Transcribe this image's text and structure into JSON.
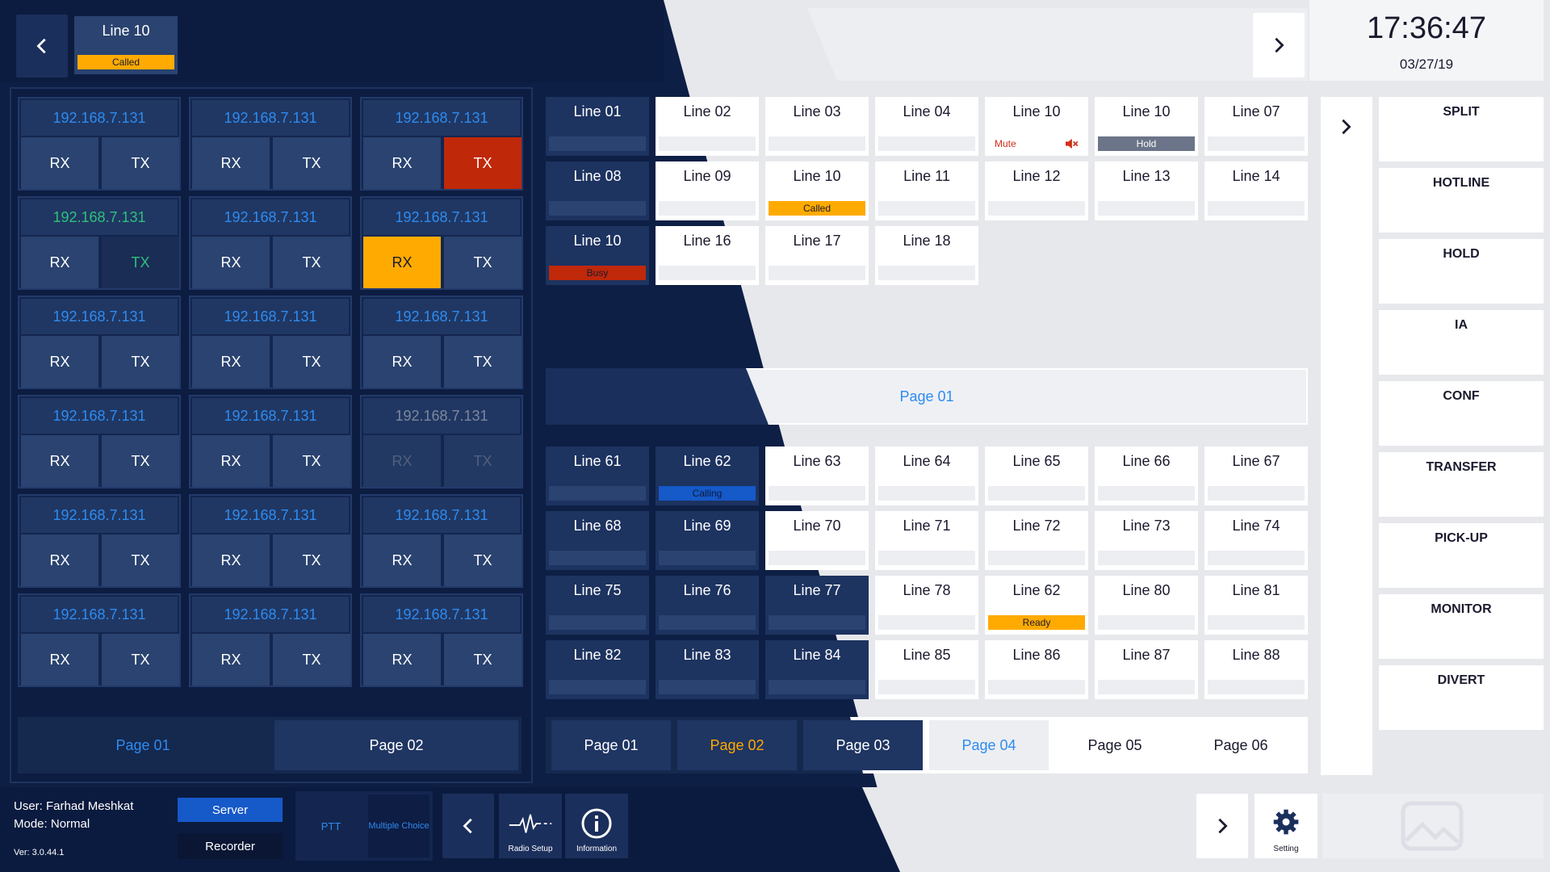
{
  "top": {
    "active_line_label": "Line 10",
    "active_line_status": "Called",
    "time": "17:36:47",
    "date": "03/27/19"
  },
  "radios": [
    {
      "ip": "192.168.7.131",
      "rx": "RX",
      "tx": "TX"
    },
    {
      "ip": "192.168.7.131",
      "rx": "RX",
      "tx": "TX"
    },
    {
      "ip": "192.168.7.131",
      "rx": "RX",
      "tx": "TX"
    },
    {
      "ip": "192.168.7.131",
      "rx": "RX",
      "tx": "TX"
    },
    {
      "ip": "192.168.7.131",
      "rx": "RX",
      "tx": "TX"
    },
    {
      "ip": "192.168.7.131",
      "rx": "RX",
      "tx": "TX"
    },
    {
      "ip": "192.168.7.131",
      "rx": "RX",
      "tx": "TX"
    },
    {
      "ip": "192.168.7.131",
      "rx": "RX",
      "tx": "TX"
    },
    {
      "ip": "192.168.7.131",
      "rx": "RX",
      "tx": "TX"
    },
    {
      "ip": "192.168.7.131",
      "rx": "RX",
      "tx": "TX"
    },
    {
      "ip": "192.168.7.131",
      "rx": "RX",
      "tx": "TX"
    },
    {
      "ip": "192.168.7.131",
      "rx": "RX",
      "tx": "TX"
    },
    {
      "ip": "192.168.7.131",
      "rx": "RX",
      "tx": "TX"
    },
    {
      "ip": "192.168.7.131",
      "rx": "RX",
      "tx": "TX"
    },
    {
      "ip": "192.168.7.131",
      "rx": "RX",
      "tx": "TX"
    },
    {
      "ip": "192.168.7.131",
      "rx": "RX",
      "tx": "TX"
    },
    {
      "ip": "192.168.7.131",
      "rx": "RX",
      "tx": "TX"
    },
    {
      "ip": "192.168.7.131",
      "rx": "RX",
      "tx": "TX"
    }
  ],
  "radio_pages": [
    "Page 01",
    "Page 02"
  ],
  "lines_top": [
    {
      "label": "Line 01",
      "status": ""
    },
    {
      "label": "Line 02",
      "status": ""
    },
    {
      "label": "Line 03",
      "status": ""
    },
    {
      "label": "Line 04",
      "status": ""
    },
    {
      "label": "Line 10",
      "status": "Mute"
    },
    {
      "label": "Line 10",
      "status": "Hold"
    },
    {
      "label": "Line 07",
      "status": ""
    },
    {
      "label": "Line 08",
      "status": ""
    },
    {
      "label": "Line 09",
      "status": ""
    },
    {
      "label": "Line 10",
      "status": "Called"
    },
    {
      "label": "Line 11",
      "status": ""
    },
    {
      "label": "Line 12",
      "status": ""
    },
    {
      "label": "Line 13",
      "status": ""
    },
    {
      "label": "Line 14",
      "status": ""
    },
    {
      "label": "Line 10",
      "status": "Busy"
    },
    {
      "label": "Line 16",
      "status": ""
    },
    {
      "label": "Line 17",
      "status": ""
    },
    {
      "label": "Line 18",
      "status": ""
    }
  ],
  "middle_page": "Page 01",
  "lines_bottom": [
    {
      "label": "Line 61",
      "status": ""
    },
    {
      "label": "Line 62",
      "status": "Calling"
    },
    {
      "label": "Line 63",
      "status": ""
    },
    {
      "label": "Line 64",
      "status": ""
    },
    {
      "label": "Line 65",
      "status": ""
    },
    {
      "label": "Line 66",
      "status": ""
    },
    {
      "label": "Line 67",
      "status": ""
    },
    {
      "label": "Line 68",
      "status": ""
    },
    {
      "label": "Line 69",
      "status": ""
    },
    {
      "label": "Line 70",
      "status": ""
    },
    {
      "label": "Line 71",
      "status": ""
    },
    {
      "label": "Line 72",
      "status": ""
    },
    {
      "label": "Line 73",
      "status": ""
    },
    {
      "label": "Line 74",
      "status": ""
    },
    {
      "label": "Line 75",
      "status": ""
    },
    {
      "label": "Line 76",
      "status": ""
    },
    {
      "label": "Line 77",
      "status": ""
    },
    {
      "label": "Line 78",
      "status": ""
    },
    {
      "label": "Line 62",
      "status": "Ready"
    },
    {
      "label": "Line 80",
      "status": ""
    },
    {
      "label": "Line 81",
      "status": ""
    },
    {
      "label": "Line 82",
      "status": ""
    },
    {
      "label": "Line 83",
      "status": ""
    },
    {
      "label": "Line 84",
      "status": ""
    },
    {
      "label": "Line 85",
      "status": ""
    },
    {
      "label": "Line 86",
      "status": ""
    },
    {
      "label": "Line 87",
      "status": ""
    },
    {
      "label": "Line 88",
      "status": ""
    }
  ],
  "line_pages": [
    "Page 01",
    "Page 02",
    "Page 03",
    "Page 04",
    "Page 05",
    "Page 06"
  ],
  "functions": [
    "SPLIT",
    "HOTLINE",
    "HOLD",
    "IA",
    "CONF",
    "TRANSFER",
    "PICK-UP",
    "MONITOR",
    "DIVERT"
  ],
  "footer": {
    "user": "User: Farhad Meshkat",
    "mode": "Mode: Normal",
    "version": "Ver: 3.0.44.1",
    "server": "Server",
    "recorder": "Recorder",
    "ptt": "PTT",
    "multiple_choice": "Multiple Choice",
    "radio_setup": "Radio Setup",
    "information": "Information",
    "setting": "Setting"
  },
  "colors": {
    "dark_bg": "#0e1f45",
    "light_bg": "#e7e8ec",
    "accent_blue": "#2e8bf0",
    "amber": "#ffaa00",
    "red": "#c0280a",
    "green": "#2fc07a"
  }
}
